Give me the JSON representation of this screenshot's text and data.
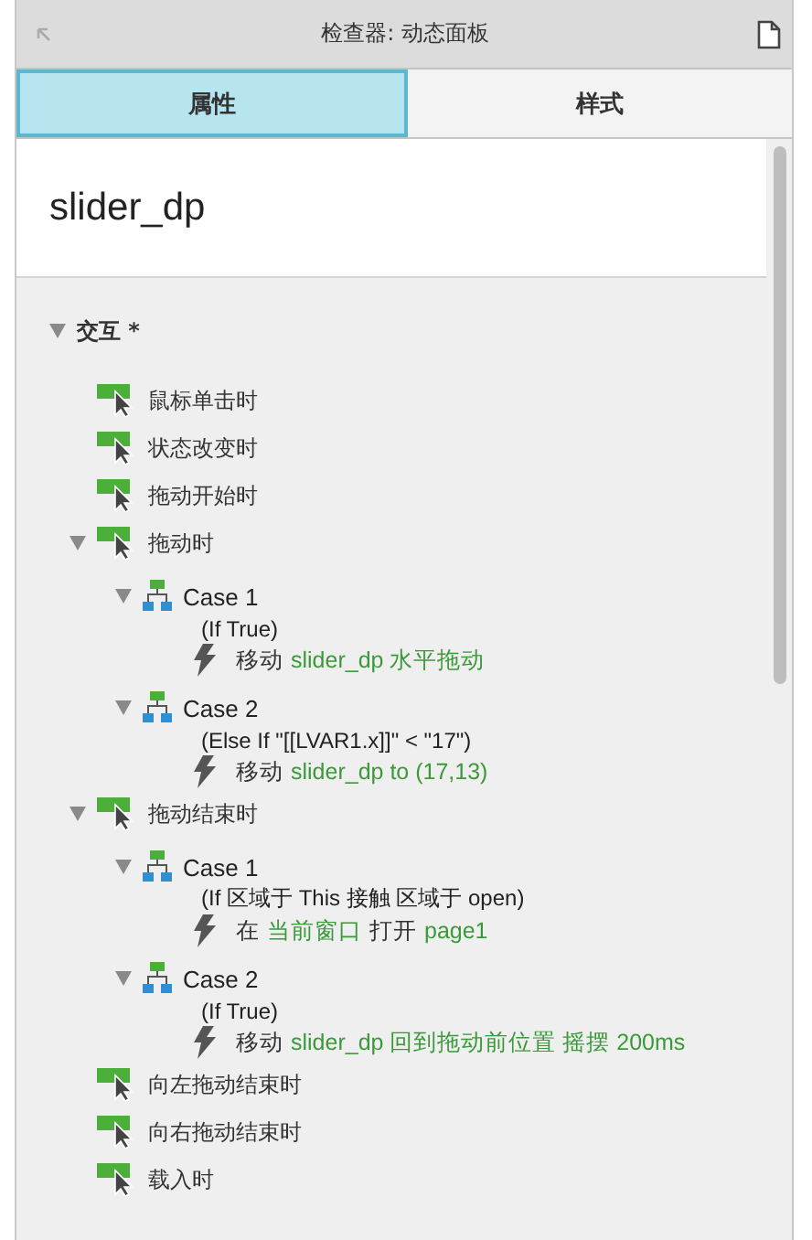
{
  "window": {
    "title": "检查器: 动态面板"
  },
  "tabs": [
    {
      "label": "属性",
      "selected": true
    },
    {
      "label": "样式",
      "selected": false
    }
  ],
  "widget_name": "slider_dp",
  "section": {
    "title": "交互 *",
    "expanded": true
  },
  "events": [
    {
      "label": "鼠标单击时"
    },
    {
      "label": "状态改变时"
    },
    {
      "label": "拖动开始时"
    },
    {
      "label": "拖动时",
      "expanded": true,
      "cases": [
        {
          "title": "Case 1",
          "expanded": true,
          "condition": "(If True)",
          "actions": [
            [
              {
                "kind": "plain",
                "text": "移动"
              },
              {
                "kind": "target",
                "text": "slider_dp 水平拖动"
              }
            ]
          ]
        },
        {
          "title": "Case 2",
          "expanded": true,
          "condition": "(Else If \"[[LVAR1.x]]\" < \"17\")",
          "actions": [
            [
              {
                "kind": "plain",
                "text": "移动"
              },
              {
                "kind": "target",
                "text": "slider_dp to (17,13)"
              }
            ]
          ]
        }
      ]
    },
    {
      "label": "拖动结束时",
      "expanded": true,
      "cases": [
        {
          "title": "Case 1",
          "expanded": true,
          "condition": "(If 区域于 This 接触 区域于 open)",
          "actions": [
            [
              {
                "kind": "plain",
                "text": "在"
              },
              {
                "kind": "target",
                "text": "当前窗口"
              },
              {
                "kind": "plain",
                "text": "打开"
              },
              {
                "kind": "target",
                "text": "page1"
              }
            ]
          ]
        },
        {
          "title": "Case 2",
          "expanded": true,
          "condition": "(If True)",
          "actions": [
            [
              {
                "kind": "plain",
                "text": "移动"
              },
              {
                "kind": "target",
                "text": "slider_dp 回到拖动前位置 摇摆 200ms"
              }
            ]
          ]
        }
      ]
    },
    {
      "label": "向左拖动结束时"
    },
    {
      "label": "向右拖动结束时"
    },
    {
      "label": "载入时"
    }
  ]
}
